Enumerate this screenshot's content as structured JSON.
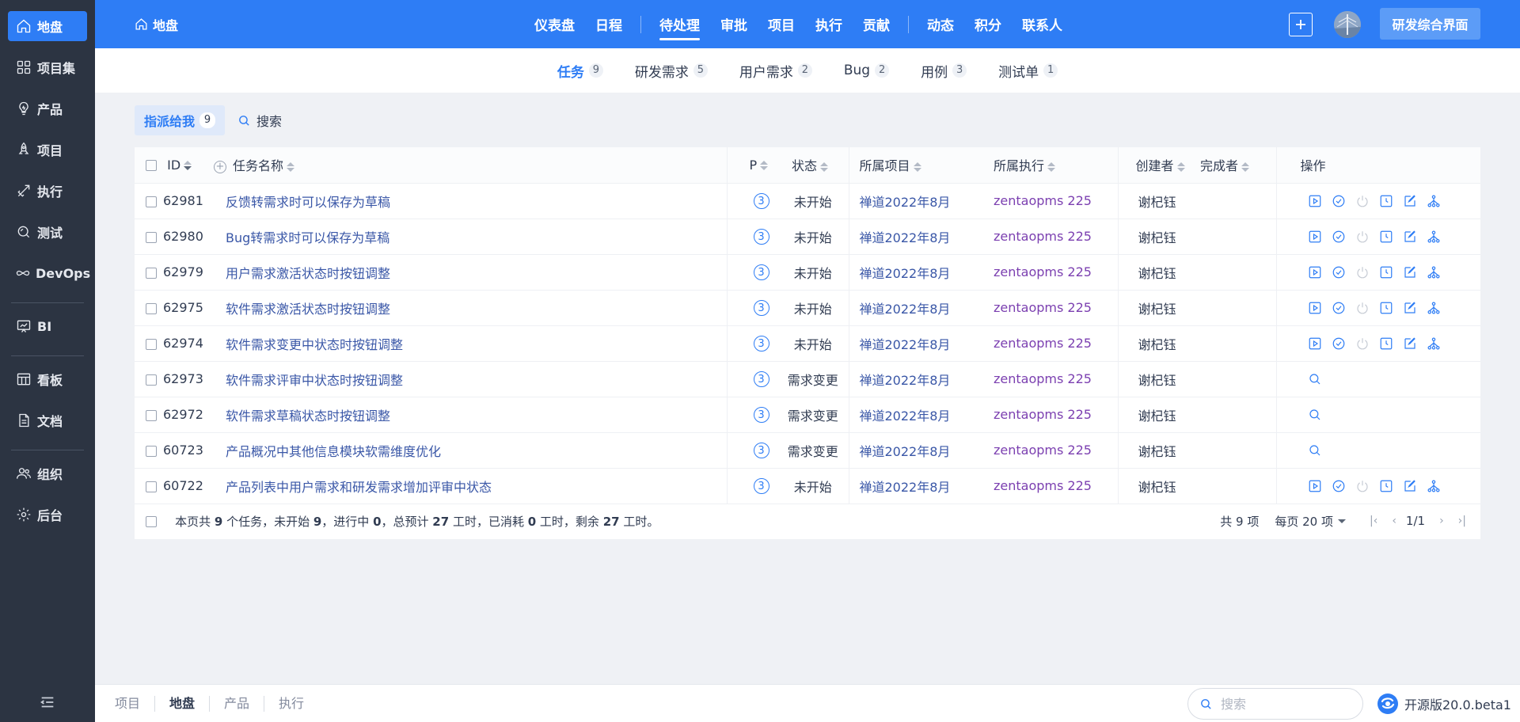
{
  "sidebar": {
    "items": [
      {
        "label": "地盘",
        "icon": "home-icon",
        "active": true
      },
      {
        "label": "项目集",
        "icon": "grid-icon"
      },
      {
        "label": "产品",
        "icon": "bulb-icon"
      },
      {
        "label": "项目",
        "icon": "rocket-icon"
      },
      {
        "label": "执行",
        "icon": "arrow-icon"
      },
      {
        "label": "测试",
        "icon": "test-icon"
      },
      {
        "label": "DevOps",
        "icon": "infinity-icon"
      },
      {
        "label": "BI",
        "icon": "chart-icon"
      },
      {
        "label": "看板",
        "icon": "kanban-icon"
      },
      {
        "label": "文档",
        "icon": "doc-icon"
      },
      {
        "label": "组织",
        "icon": "users-icon"
      },
      {
        "label": "后台",
        "icon": "gear-icon"
      }
    ]
  },
  "header": {
    "crumb": "地盘",
    "nav": [
      "仪表盘",
      "日程",
      "待处理",
      "审批",
      "项目",
      "执行",
      "贡献",
      "动态",
      "积分",
      "联系人"
    ],
    "active_nav": "待处理",
    "env_button": "研发综合界面"
  },
  "subtabs": [
    {
      "label": "任务",
      "count": "9",
      "active": true
    },
    {
      "label": "研发需求",
      "count": "5"
    },
    {
      "label": "用户需求",
      "count": "2"
    },
    {
      "label": "Bug",
      "count": "2"
    },
    {
      "label": "用例",
      "count": "3"
    },
    {
      "label": "测试单",
      "count": "1"
    }
  ],
  "filter": {
    "assigned_label": "指派给我",
    "assigned_count": "9",
    "search_label": "搜索"
  },
  "table": {
    "headers": {
      "id": "ID",
      "name": "任务名称",
      "priority": "P",
      "status": "状态",
      "project": "所属项目",
      "execution": "所属执行",
      "creator": "创建者",
      "finisher": "完成者",
      "actions": "操作"
    },
    "rows": [
      {
        "id": "62981",
        "name": "反馈转需求时可以保存为草稿",
        "pri": "3",
        "status": "未开始",
        "project": "禅道2022年8月",
        "execution": "zentaopms 225",
        "creator": "谢杞钰",
        "finisher": "",
        "actions": "full"
      },
      {
        "id": "62980",
        "name": "Bug转需求时可以保存为草稿",
        "pri": "3",
        "status": "未开始",
        "project": "禅道2022年8月",
        "execution": "zentaopms 225",
        "creator": "谢杞钰",
        "finisher": "",
        "actions": "full"
      },
      {
        "id": "62979",
        "name": "用户需求激活状态时按钮调整",
        "pri": "3",
        "status": "未开始",
        "project": "禅道2022年8月",
        "execution": "zentaopms 225",
        "creator": "谢杞钰",
        "finisher": "",
        "actions": "full"
      },
      {
        "id": "62975",
        "name": "软件需求激活状态时按钮调整",
        "pri": "3",
        "status": "未开始",
        "project": "禅道2022年8月",
        "execution": "zentaopms 225",
        "creator": "谢杞钰",
        "finisher": "",
        "actions": "full"
      },
      {
        "id": "62974",
        "name": "软件需求变更中状态时按钮调整",
        "pri": "3",
        "status": "未开始",
        "project": "禅道2022年8月",
        "execution": "zentaopms 225",
        "creator": "谢杞钰",
        "finisher": "",
        "actions": "full"
      },
      {
        "id": "62973",
        "name": "软件需求评审中状态时按钮调整",
        "pri": "3",
        "status": "需求变更",
        "project": "禅道2022年8月",
        "execution": "zentaopms 225",
        "creator": "谢杞钰",
        "finisher": "",
        "actions": "search"
      },
      {
        "id": "62972",
        "name": "软件需求草稿状态时按钮调整",
        "pri": "3",
        "status": "需求变更",
        "project": "禅道2022年8月",
        "execution": "zentaopms 225",
        "creator": "谢杞钰",
        "finisher": "",
        "actions": "search"
      },
      {
        "id": "60723",
        "name": "产品概况中其他信息模块软需维度优化",
        "pri": "3",
        "status": "需求变更",
        "project": "禅道2022年8月",
        "execution": "zentaopms 225",
        "creator": "谢杞钰",
        "finisher": "",
        "actions": "search"
      },
      {
        "id": "60722",
        "name": "产品列表中用户需求和研发需求增加评审中状态",
        "pri": "3",
        "status": "未开始",
        "project": "禅道2022年8月",
        "execution": "zentaopms 225",
        "creator": "谢杞钰",
        "finisher": "",
        "actions": "full"
      }
    ],
    "summary": {
      "t1": "本页共 ",
      "count": "9",
      "t2": " 个任务，未开始 ",
      "wait": "9",
      "t3": "，进行中 ",
      "doing": "0",
      "t4": "，总预计 ",
      "estimate": "27",
      "t5": " 工时，已消耗 ",
      "consumed": "0",
      "t6": " 工时，剩余 ",
      "left": "27",
      "t7": " 工时。"
    },
    "pager": {
      "total": "共 9 项",
      "per_page": "每页 20 项",
      "page": "1/1"
    }
  },
  "footer": {
    "crumbs": [
      "项目",
      "地盘",
      "产品",
      "执行"
    ],
    "active_crumb": "地盘",
    "search_placeholder": "搜索",
    "version": "开源版20.0.beta1"
  },
  "colors": {
    "primary": "#2e7df5",
    "sidebar_bg": "#2c3442",
    "task_link": "#3a57a7",
    "exec_link": "#7b3fb0"
  }
}
